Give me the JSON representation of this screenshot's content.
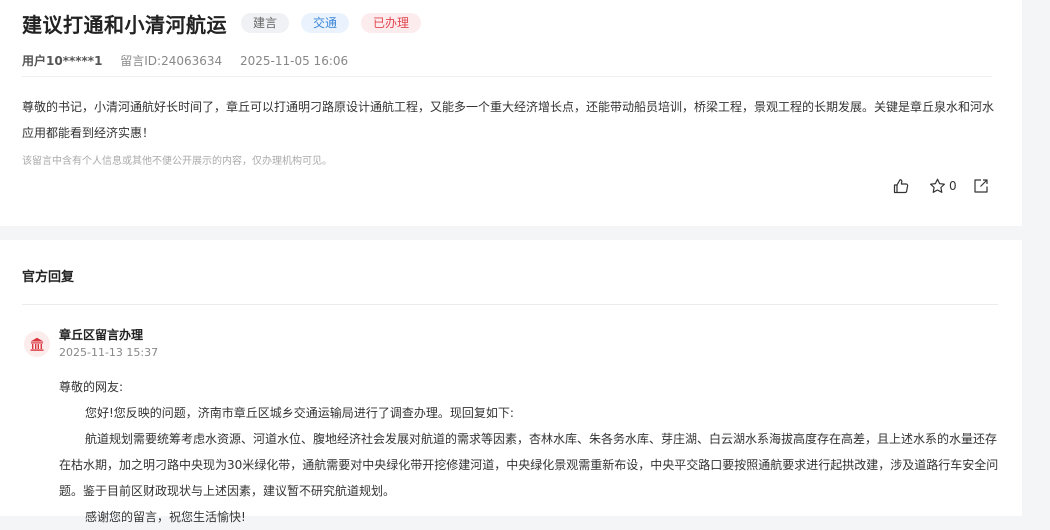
{
  "message": {
    "title": "建议打通和小清河航运",
    "tags": [
      "建言",
      "交通",
      "已办理"
    ],
    "user": "用户10*****1",
    "message_id": "留言ID:24063634",
    "datetime": "2025-11-05 16:06",
    "content": "尊敬的书记，小清河通航好长时间了，章丘可以打通明刁路原设计通航工程，又能多一个重大经济增长点，还能带动船员培训，桥梁工程，景观工程的长期发展。关键是章丘泉水和河水应用都能看到经济实惠！",
    "privacy_note": "该留言中含有个人信息或其他不便公开展示的内容，仅办理机构可见。",
    "star_count": "0"
  },
  "reply": {
    "section_title": "官方回复",
    "org_name": "章丘区留言办理",
    "datetime": "2025-11-13 15:37",
    "greeting": "尊敬的网友:",
    "paragraphs": [
      "您好!您反映的问题，济南市章丘区城乡交通运输局进行了调查办理。现回复如下:",
      "航道规划需要统筹考虑水资源、河道水位、腹地经济社会发展对航道的需求等因素，杏林水库、朱各务水库、芽庄湖、白云湖水系海拔高度存在高差，且上述水系的水量还存在枯水期，加之明刁路中央现为30米绿化带，通航需要对中央绿化带开挖修建河道，中央绿化景观需重新布设，中央平交路口要按照通航要求进行起拱改建，涉及道路行车安全问题。鉴于目前区财政现状与上述因素，建议暂不研究航道规划。",
      "感谢您的留言，祝您生活愉快!"
    ]
  },
  "icons": {
    "like": "thumbs-up-icon",
    "star": "star-icon",
    "share": "share-icon",
    "org": "government-building-icon"
  },
  "colors": {
    "tag_gray_bg": "#f0f1f4",
    "tag_blue": "#3e86d8",
    "tag_red": "#e0464f",
    "org_icon": "#d9363e"
  }
}
